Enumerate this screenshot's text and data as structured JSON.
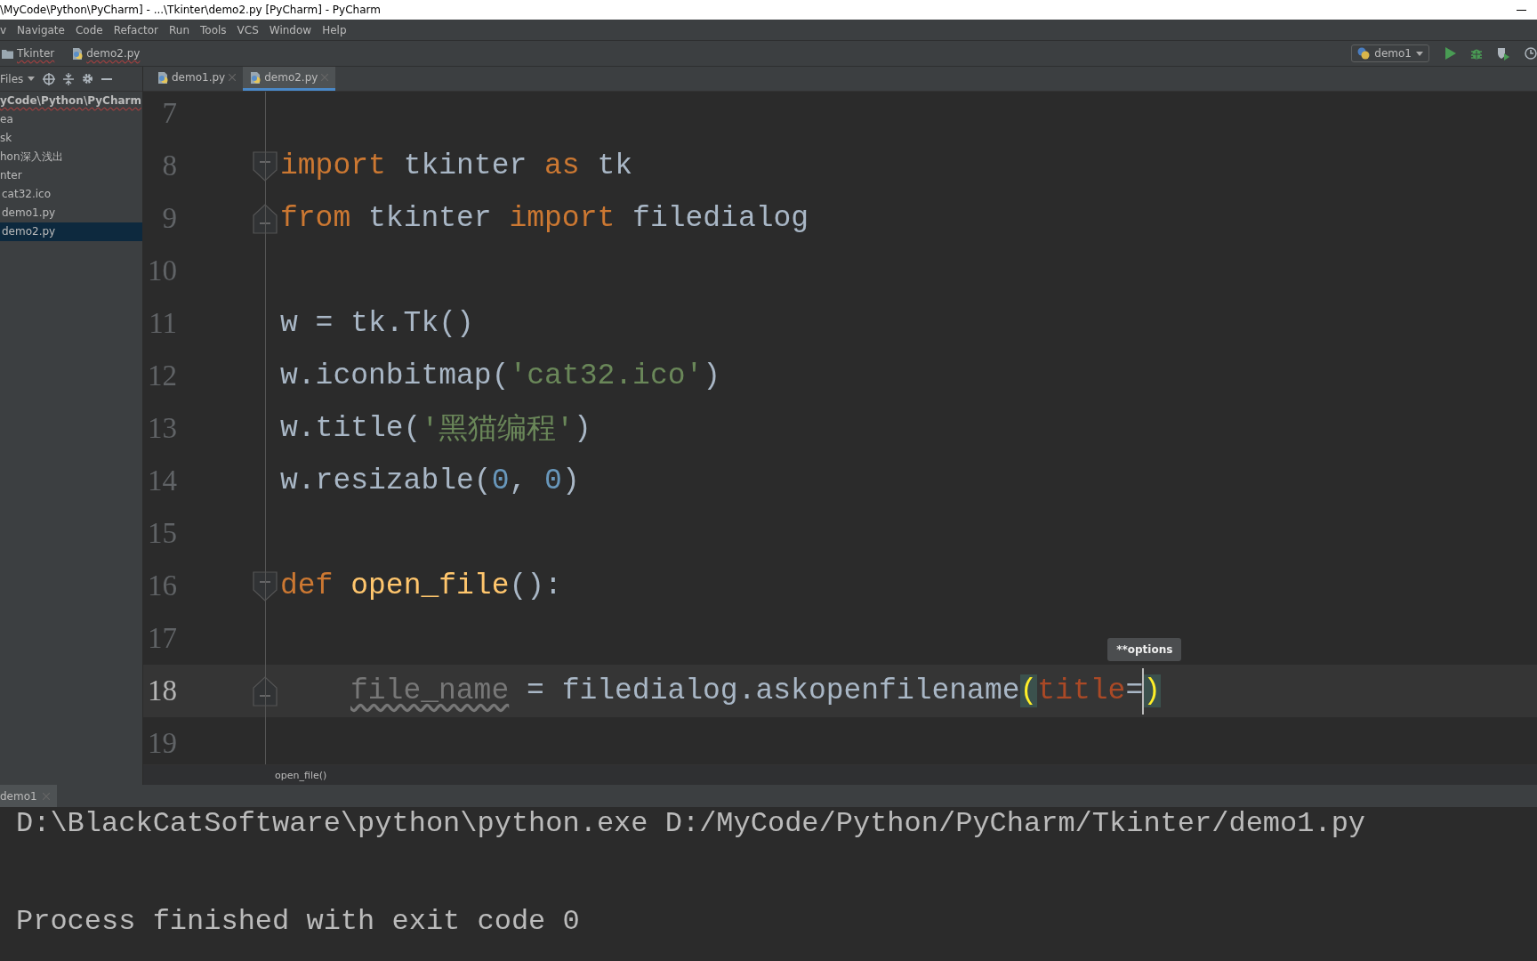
{
  "window": {
    "title": "\\MyCode\\Python\\PyCharm] - ...\\Tkinter\\demo2.py [PyCharm] - PyCharm"
  },
  "menu": [
    "v",
    "Navigate",
    "Code",
    "Refactor",
    "Run",
    "Tools",
    "VCS",
    "Window",
    "Help"
  ],
  "navbar": {
    "breadcrumbs": [
      {
        "label": "Tkinter",
        "kind": "folder"
      },
      {
        "label": "demo2.py",
        "kind": "python"
      }
    ],
    "run_config": "demo1"
  },
  "sidebar": {
    "view": "Files",
    "tree": [
      {
        "label": "yCode\\Python\\PyCharm",
        "selected": false,
        "children": [
          {
            "label": "ea",
            "selected": false
          },
          {
            "label": "sk",
            "selected": false
          },
          {
            "label": "hon深入浅出",
            "selected": false
          },
          {
            "label": "nter",
            "selected": false,
            "children": [
              {
                "label": "cat32.ico",
                "selected": false
              },
              {
                "label": "demo1.py",
                "selected": false
              },
              {
                "label": "demo2.py",
                "selected": true
              }
            ]
          }
        ]
      }
    ]
  },
  "tabs": [
    {
      "label": "demo1.py",
      "selected": false
    },
    {
      "label": "demo2.py",
      "selected": true
    }
  ],
  "editor": {
    "tooltip": "**options",
    "lines": [
      {
        "number": "7",
        "current": false
      },
      {
        "number": "8",
        "fold_open": true,
        "current": false,
        "tokens": [
          {
            "kind": "keyword",
            "text": "import"
          },
          {
            "kind": "plain",
            "text": " tkinter "
          },
          {
            "kind": "keyword",
            "text": "as"
          },
          {
            "kind": "plain",
            "text": " tk"
          }
        ]
      },
      {
        "number": "9",
        "fold_close": true,
        "current": false,
        "tokens": [
          {
            "kind": "keyword",
            "text": "from"
          },
          {
            "kind": "plain",
            "text": " tkinter "
          },
          {
            "kind": "keyword",
            "text": "import"
          },
          {
            "kind": "plain",
            "text": " filedialog"
          }
        ]
      },
      {
        "number": "10",
        "current": false
      },
      {
        "number": "11",
        "current": false,
        "tokens": [
          {
            "kind": "plain",
            "text": "w = tk.Tk()"
          }
        ]
      },
      {
        "number": "12",
        "current": false,
        "tokens": [
          {
            "kind": "plain",
            "text": "w.iconbitmap("
          },
          {
            "kind": "string",
            "text": "'cat32.ico'"
          },
          {
            "kind": "plain",
            "text": ")"
          }
        ]
      },
      {
        "number": "13",
        "current": false,
        "tokens": [
          {
            "kind": "plain",
            "text": "w.title("
          },
          {
            "kind": "string",
            "text": "'黑猫编程'"
          },
          {
            "kind": "plain",
            "text": ")"
          }
        ]
      },
      {
        "number": "14",
        "current": false,
        "tokens": [
          {
            "kind": "plain",
            "text": "w.resizable("
          },
          {
            "kind": "number",
            "text": "0"
          },
          {
            "kind": "plain",
            "text": ", "
          },
          {
            "kind": "number",
            "text": "0"
          },
          {
            "kind": "plain",
            "text": ")"
          }
        ]
      },
      {
        "number": "15",
        "current": false
      },
      {
        "number": "16",
        "fold_open": true,
        "current": false,
        "tokens": [
          {
            "kind": "keyword",
            "text": "def"
          },
          {
            "kind": "func",
            "text": " open_file"
          },
          {
            "kind": "plain",
            "text": "():"
          }
        ]
      },
      {
        "number": "17",
        "current": false
      },
      {
        "number": "18",
        "fold_close": true,
        "current": true,
        "indent": true,
        "tokens": [
          {
            "kind": "warn",
            "text": "file_name"
          },
          {
            "kind": "plain",
            "text": " = filedialog.askopenfilename"
          },
          {
            "kind": "paren",
            "text": "("
          },
          {
            "kind": "param",
            "text": "title"
          },
          {
            "kind": "plain",
            "text": "="
          },
          {
            "kind": "paren",
            "text": ")",
            "caret": true
          }
        ]
      },
      {
        "number": "19",
        "current": false
      }
    ]
  },
  "breadcrumb": "open_file()",
  "run_panel": {
    "tab": "demo1",
    "output": [
      "D:\\BlackCatSoftware\\python\\python.exe D:/MyCode/Python/PyCharm/Tkinter/demo1.py",
      "Process finished with exit code 0"
    ]
  }
}
